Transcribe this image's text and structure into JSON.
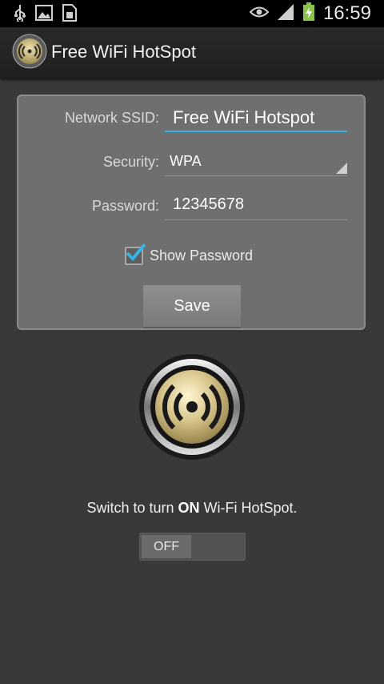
{
  "status_bar": {
    "time": "16:59",
    "icons": [
      "usb-icon",
      "image-icon",
      "sim-icon",
      "eye-icon",
      "signal-icon",
      "battery-charging-icon"
    ]
  },
  "app_bar": {
    "title": "Free WiFi HotSpot",
    "icon": "wifi-hotspot-icon"
  },
  "form": {
    "ssid_label": "Network SSID:",
    "ssid_value": "Free WiFi Hotspot",
    "security_label": "Security:",
    "security_value": "WPA",
    "password_label": "Password:",
    "password_value": "12345678",
    "show_password_label": "Show Password",
    "show_password_checked": true,
    "save_label": "Save"
  },
  "hotspot": {
    "switch_prefix": "Switch to turn ",
    "switch_emphasis": "ON",
    "switch_suffix": " Wi-Fi HotSpot.",
    "toggle_label": "OFF",
    "toggle_state": "off"
  },
  "colors": {
    "background": "#393939",
    "accent": "#33b5e5",
    "panel": "#6f6f6f",
    "gold": "#c9b27a"
  }
}
